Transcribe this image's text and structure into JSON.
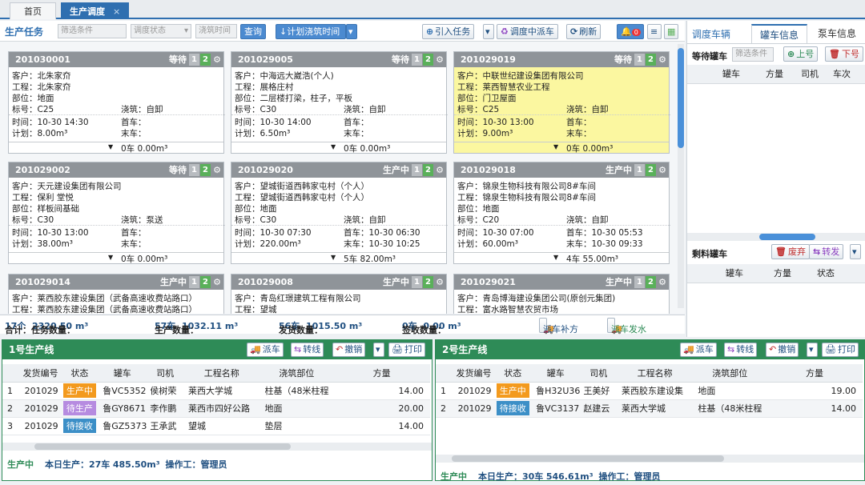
{
  "tabs": [
    {
      "label": "首页"
    },
    {
      "label": "生产调度",
      "close": "×"
    }
  ],
  "toolbar": {
    "title": "生产任务",
    "filter_placeholder": "筛选条件",
    "status_select": "调度状态",
    "pour_select": "浇筑时间",
    "query": "查询",
    "sort": "↓计划浇筑时间",
    "import": "引入任务",
    "dispatch": "调度中派车",
    "refresh": "刷新",
    "bell_count": "0"
  },
  "cards": [
    {
      "id": "201030001",
      "status": "等待",
      "n1": "1",
      "n2": "2",
      "customer": "客户：北朱家夼",
      "project": "工程：北朱家夼",
      "part": "部位：地面",
      "grade": "标号：C25",
      "pour": "浇筑：自卸",
      "time": "时间：10-30 14:30",
      "plan": "计划：8.00m³",
      "first": "首车：",
      "last": "末车：",
      "count": "0车  0.00m³"
    },
    {
      "id": "201029005",
      "status": "等待",
      "n1": "1",
      "n2": "2",
      "customer": "客户：中海远大崴浩(个人)",
      "project": "工程：展格庄村",
      "part": "部位：二层楼打梁，柱子，平板",
      "grade": "标号：C30",
      "pour": "浇筑：自卸",
      "time": "时间：10-30 14:00",
      "plan": "计划：6.50m³",
      "first": "首车：",
      "last": "末车：",
      "count": "0车  0.00m³"
    },
    {
      "id": "201029019",
      "status": "等待",
      "n1": "1",
      "n2": "2",
      "highlight": true,
      "customer": "客户：中联世纪建设集团有限公司",
      "project": "工程：莱西智慧农业工程",
      "part": "部位：门卫屋面",
      "grade": "标号：C25",
      "pour": "浇筑：自卸",
      "time": "时间：10-30 13:00",
      "plan": "计划：9.00m³",
      "first": "首车：",
      "last": "末车：",
      "count": "0车  0.00m³"
    },
    {
      "id": "201029002",
      "status": "等待",
      "n1": "1",
      "n2": "2",
      "customer": "客户：天元建设集团有限公司",
      "project": "工程：保利 堂悦",
      "part": "部位：样板间基础",
      "grade": "标号：C30",
      "pour": "浇筑：泵送",
      "time": "时间：10-30 13:00",
      "plan": "计划：38.00m³",
      "first": "首车：",
      "last": "末车：",
      "count": "0车  0.00m³"
    },
    {
      "id": "201029020",
      "status": "生产中",
      "n1": "1",
      "n2": "2",
      "customer": "客户：望城街道西韩家屯村（个人）",
      "project": "工程：望城街道西韩家屯村（个人）",
      "part": "部位：地面",
      "grade": "标号：C30",
      "pour": "浇筑：自卸",
      "time": "时间：10-30 07:30",
      "plan": "计划：220.00m³",
      "first": "首车：10-30 06:30",
      "last": "末车：10-30 10:25",
      "count": "5车  82.00m³"
    },
    {
      "id": "201029018",
      "status": "生产中",
      "n1": "1",
      "n2": "2",
      "customer": "客户：锦泉生物科技有限公司8#车间",
      "project": "工程：锦泉生物科技有限公司8#车间",
      "part": "部位：地面",
      "grade": "标号：C20",
      "pour": "浇筑：自卸",
      "time": "时间：10-30 07:00",
      "plan": "计划：60.00m³",
      "first": "首车：10-30 05:53",
      "last": "末车：10-30 09:33",
      "count": "4车  55.00m³"
    },
    {
      "id": "201029014",
      "status": "生产中",
      "n1": "1",
      "n2": "2",
      "customer": "客户：莱西胶东建设集团（武备高速收费站路口）",
      "project": "工程：莱西胶东建设集团（武备高速收费站路口）"
    },
    {
      "id": "201029008",
      "status": "生产中",
      "n1": "1",
      "n2": "2",
      "customer": "客户：青岛红璟建筑工程有限公司",
      "project": "工程：望城"
    },
    {
      "id": "201029021",
      "status": "生产中",
      "n1": "1",
      "n2": "2",
      "customer": "客户：青岛博海建设集团公司(原创元集团)",
      "project": "工程：富水路智慧农贸市场"
    }
  ],
  "summary": {
    "total_label": "合计：任务数量：",
    "total_tasks": "17个",
    "total_vol": "2320.50 m³",
    "prod_label": "生产数量：",
    "prod_cars": "57车",
    "prod_vol": "1032.11 m³",
    "ship_label": "发货数量：",
    "ship_cars": "56车",
    "ship_vol": "1015.50 m³",
    "sign_label": "签收数量：",
    "sign_cars": "0车",
    "sign_vol": "0.00 m³",
    "btn_supply": "派车补方",
    "btn_send": "派车发水"
  },
  "right": {
    "title": "调度车辆",
    "tab1": "罐车信息",
    "tab2": "泵车信息",
    "wait_label": "等待罐车",
    "wait_filter": "筛选条件",
    "up": "上号",
    "down": "下号",
    "cols": [
      "罐车",
      "方量",
      "司机",
      "车次"
    ],
    "rem_label": "剩料罐车",
    "discard": "废弃",
    "transfer": "转发",
    "rem_cols": [
      "罐车",
      "方量",
      "状态"
    ]
  },
  "line1": {
    "title": "1号生产线",
    "btns": [
      "派车",
      "转线",
      "撤销",
      "打印"
    ],
    "cols": [
      "",
      "发货编号",
      "状态",
      "罐车",
      "司机",
      "工程名称",
      "浇筑部位",
      "方量"
    ],
    "rows": [
      {
        "no": "1",
        "code": "201029",
        "status": "生产中",
        "color": "#f39a1e",
        "truck": "鲁VC5352",
        "driver": "侯树荣",
        "project": "莱西大学城",
        "part": "柱基（48米柱程",
        "vol": "14.00"
      },
      {
        "no": "2",
        "code": "201029",
        "status": "待生产",
        "color": "#b68be0",
        "truck": "鲁GY8671",
        "driver": "李作鹏",
        "project": "莱西市四好公路",
        "part": "地面",
        "vol": "20.00"
      },
      {
        "no": "3",
        "code": "201029",
        "status": "待接收",
        "color": "#3c8fc7",
        "truck": "鲁GZ5373",
        "driver": "王承武",
        "project": "望城",
        "part": "垫层",
        "vol": "14.00"
      }
    ],
    "foot_status": "生产中",
    "foot_today": "本日生产：",
    "foot_cars": "27车",
    "foot_vol": "485.50m³",
    "foot_op": "操作工：",
    "foot_user": "管理员"
  },
  "line2": {
    "title": "2号生产线",
    "btns": [
      "派车",
      "转线",
      "撤销",
      "打印"
    ],
    "cols": [
      "",
      "发货编号",
      "状态",
      "罐车",
      "司机",
      "工程名称",
      "浇筑部位",
      "方量"
    ],
    "rows": [
      {
        "no": "1",
        "code": "201029",
        "status": "生产中",
        "color": "#f39a1e",
        "truck": "鲁H32U36",
        "driver": "王美好",
        "project": "莱西胶东建设集",
        "part": "地面",
        "vol": "19.00"
      },
      {
        "no": "2",
        "code": "201029",
        "status": "待接收",
        "color": "#3c8fc7",
        "truck": "鲁VC3137",
        "driver": "赵建云",
        "project": "莱西大学城",
        "part": "柱基（48米柱程",
        "vol": "14.00"
      }
    ],
    "foot_status": "生产中",
    "foot_today": "本日生产：",
    "foot_cars": "30车",
    "foot_vol": "546.61m³",
    "foot_op": "操作工：",
    "foot_user": "管理员"
  }
}
